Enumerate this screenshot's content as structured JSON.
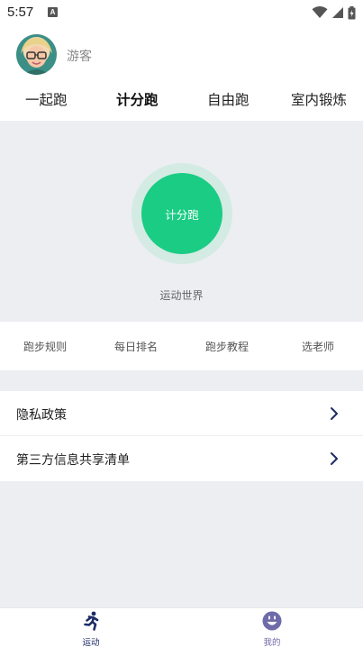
{
  "status_bar": {
    "time": "5:57",
    "notification_letter": "A"
  },
  "profile": {
    "username": "游客"
  },
  "tabs": [
    {
      "label": "一起跑",
      "active": false
    },
    {
      "label": "计分跑",
      "active": true
    },
    {
      "label": "自由跑",
      "active": false
    },
    {
      "label": "室内锻炼",
      "active": false
    }
  ],
  "main": {
    "start_button_label": "计分跑",
    "world_label": "运动世界"
  },
  "quick_links": [
    {
      "label": "跑步规则"
    },
    {
      "label": "每日排名"
    },
    {
      "label": "跑步教程"
    },
    {
      "label": "选老师"
    }
  ],
  "settings": [
    {
      "label": "隐私政策",
      "icon": "chevron-right-icon"
    },
    {
      "label": "第三方信息共享清单",
      "icon": "chevron-right-icon"
    }
  ],
  "bottom_nav": [
    {
      "label": "运动",
      "icon": "runner-icon",
      "active": true
    },
    {
      "label": "我的",
      "icon": "smiley-face-icon",
      "active": false
    }
  ],
  "colors": {
    "accent_green": "#1acc84",
    "ring_green": "#d3ebe3",
    "background_gray": "#eceef2",
    "nav_active": "#1d2b66",
    "nav_inactive": "#6f6aa8"
  }
}
